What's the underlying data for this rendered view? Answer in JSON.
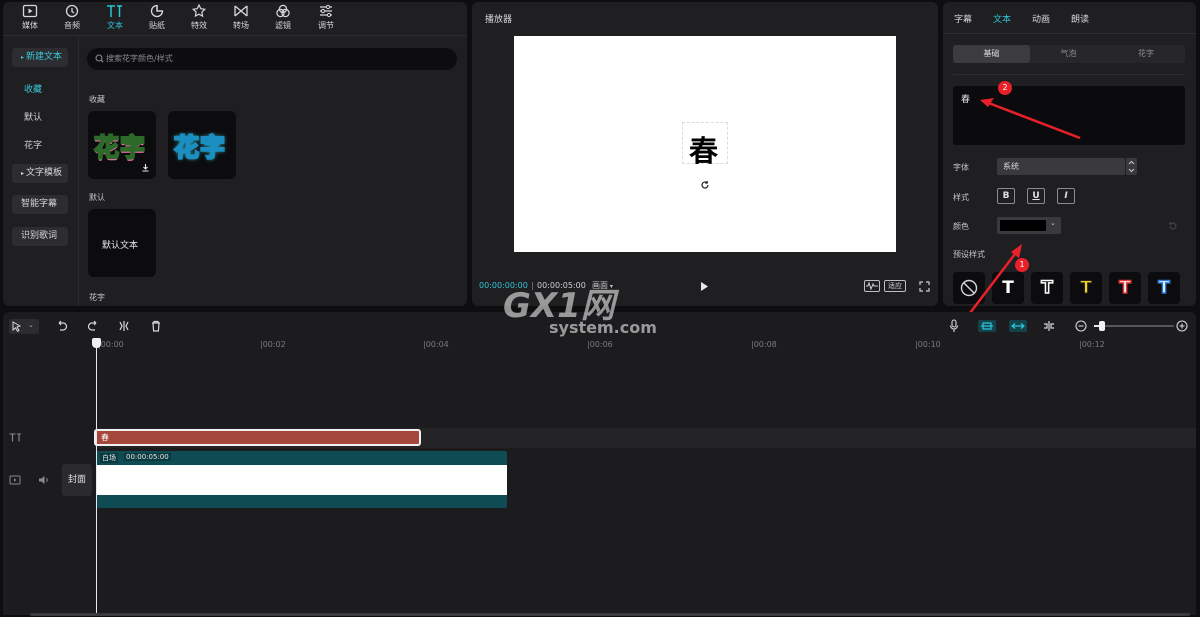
{
  "toolbar": {
    "items": [
      {
        "label": "媒体",
        "icon": "media-icon"
      },
      {
        "label": "音频",
        "icon": "audio-icon"
      },
      {
        "label": "文本",
        "icon": "text-icon",
        "active": true
      },
      {
        "label": "贴纸",
        "icon": "sticker-icon"
      },
      {
        "label": "特效",
        "icon": "effects-icon"
      },
      {
        "label": "转场",
        "icon": "transition-icon"
      },
      {
        "label": "滤镜",
        "icon": "filter-icon"
      },
      {
        "label": "调节",
        "icon": "adjust-icon"
      }
    ]
  },
  "sidebar": {
    "new_text": "新建文本",
    "favorites": "收藏",
    "default": "默认",
    "flower_text": "花字",
    "text_template": "文字模板",
    "smart_subtitle": "智能字幕",
    "lyrics": "识别歌词"
  },
  "library": {
    "search_placeholder": "搜索花字颜色/样式",
    "section_favorites": "收藏",
    "wordart_text": "花字",
    "section_default": "默认",
    "default_text": "默认文本",
    "section_flower": "花字"
  },
  "player": {
    "title": "播放器",
    "canvas_text": "春",
    "current_time": "00:00:00:00",
    "duration": "00:00:05:00",
    "ratio_label": "画面",
    "original_label": "适应"
  },
  "inspector": {
    "tabs": [
      "字幕",
      "文本",
      "动画",
      "朗读"
    ],
    "active_tab": "文本",
    "subtabs": [
      "基础",
      "气泡",
      "花字"
    ],
    "text_value": "春",
    "font_label": "字体",
    "font_value": "系统",
    "style_label": "样式",
    "bold": "B",
    "underline": "U",
    "italic": "I",
    "color_label": "颜色",
    "color_value": "#000000",
    "preset_label": "预设样式",
    "presets": [
      "T",
      "T",
      "T",
      "T",
      "T"
    ],
    "badge1": "1",
    "badge2": "2"
  },
  "timeline": {
    "ticks": [
      "00:00",
      "00:02",
      "00:04",
      "00:06",
      "00:08",
      "00:10",
      "00:12"
    ],
    "text_clip_label": "春",
    "video_clip_label": "白场",
    "video_clip_duration": "00:00:05:00",
    "cover_label": "封面"
  },
  "watermark": {
    "brand": "GX1网",
    "domain": "system.com"
  }
}
